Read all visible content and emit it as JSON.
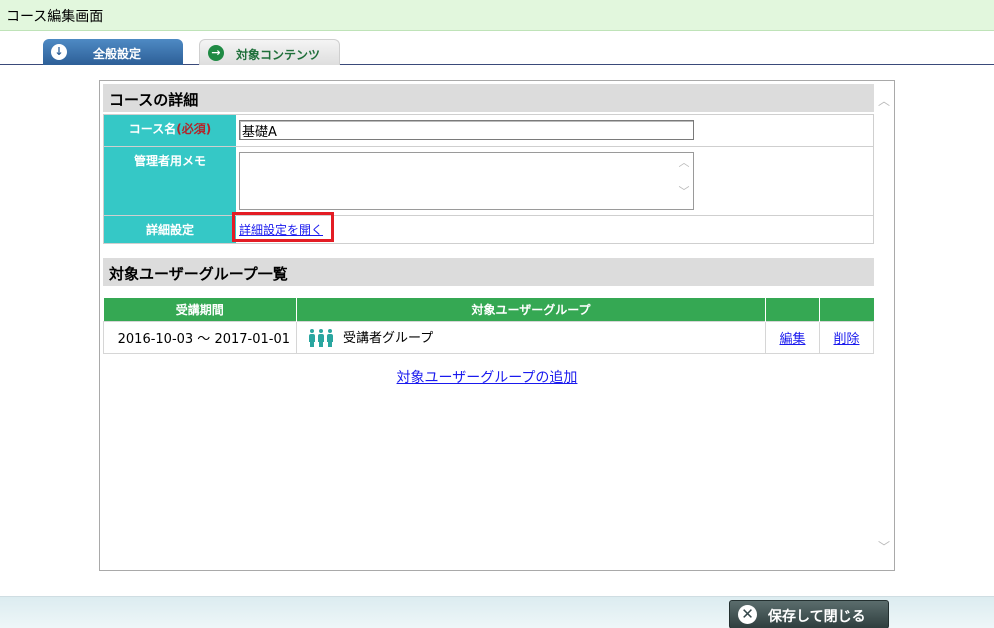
{
  "window": {
    "title": "コース編集画面"
  },
  "tabs": [
    {
      "label": "全般設定",
      "icon": "arrow-down-circle-icon",
      "active": true
    },
    {
      "label": "対象コンテンツ",
      "icon": "arrow-right-circle-icon",
      "active": false
    }
  ],
  "details": {
    "heading": "コースの詳細",
    "name_label": "コース名",
    "required_label": "(必須)",
    "name_value": "基礎A",
    "memo_label": "管理者用メモ",
    "memo_value": "",
    "advanced_label": "詳細設定",
    "advanced_link": "詳細設定を開く"
  },
  "groups": {
    "heading": "対象ユーザーグループ一覧",
    "columns": [
      "受講期間",
      "対象ユーザーグループ",
      "",
      ""
    ],
    "rows": [
      {
        "period": "2016-10-03 ～ 2017-01-01",
        "group": "受講者グループ",
        "edit": "編集",
        "delete": "削除"
      }
    ],
    "add_link": "対象ユーザーグループの追加"
  },
  "footer": {
    "save_close": "保存して閉じる"
  },
  "colors": {
    "label_bg": "#35c8c6",
    "table_header": "#35a853",
    "highlight": "#e31c24",
    "tab_active": "#2d5f97"
  }
}
